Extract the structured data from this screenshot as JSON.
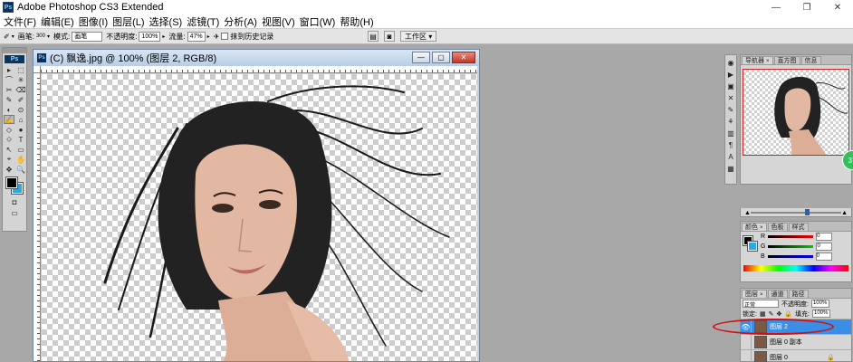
{
  "titlebar": {
    "app_icon": "Ps",
    "title": "Adobe Photoshop CS3 Extended",
    "minimize": "—",
    "restore": "❐",
    "close": "✕"
  },
  "menu": [
    "文件(F)",
    "编辑(E)",
    "图像(I)",
    "图层(L)",
    "选择(S)",
    "滤镜(T)",
    "分析(A)",
    "视图(V)",
    "窗口(W)",
    "帮助(H)"
  ],
  "options_bar": {
    "brush_label": "画笔:",
    "brush_size": "300",
    "mode_label": "模式:",
    "mode_value": "画笔",
    "opacity_label": "不透明度:",
    "opacity_value": "100%",
    "flow_label": "流量:",
    "flow_value": "47%",
    "erase_history_label": "抹到历史记录",
    "workspace_label": "工作区"
  },
  "toolbox": {
    "badge": "Ps",
    "tools": [
      "▸",
      "⬚",
      "⌒",
      "✳",
      "✂",
      "⌫",
      "✎",
      "✐",
      "◐",
      "⊙",
      "✍",
      "⌂",
      "◇",
      "●",
      "⬦",
      "T",
      "↖",
      "▭",
      "⌖",
      "✋",
      "✥",
      "🔍"
    ],
    "active_tool_index": 10,
    "foreground_color": "#000000",
    "background_color": "#29a8e8"
  },
  "document": {
    "icon": "Ps",
    "title": "(C) 飘逸.jpg @ 100% (图层 2, RGB/8)",
    "minimize": "—",
    "restore": "▢",
    "close": "✕"
  },
  "navigator_panel": {
    "tabs": [
      "导航器",
      "直方图",
      "信息"
    ],
    "zoom_badge": "37"
  },
  "color_panel": {
    "tabs": [
      "颜色",
      "色板",
      "样式"
    ],
    "channels": [
      {
        "label": "R",
        "value": "0",
        "color": "#d11"
      },
      {
        "label": "G",
        "value": "0",
        "color": "#1a1"
      },
      {
        "label": "B",
        "value": "0",
        "color": "#11d"
      }
    ]
  },
  "layers_panel": {
    "tabs": [
      "图层",
      "通道",
      "路径"
    ],
    "blend_mode": "正常",
    "opacity_label": "不透明度:",
    "opacity_value": "100%",
    "lock_label": "锁定:",
    "fill_label": "填充:",
    "fill_value": "100%",
    "layers": [
      {
        "name": "图层 2",
        "selected": true,
        "visible": true
      },
      {
        "name": "图层 0 副本",
        "selected": false,
        "visible": false
      },
      {
        "name": "图层 0",
        "selected": false,
        "visible": false
      }
    ]
  }
}
